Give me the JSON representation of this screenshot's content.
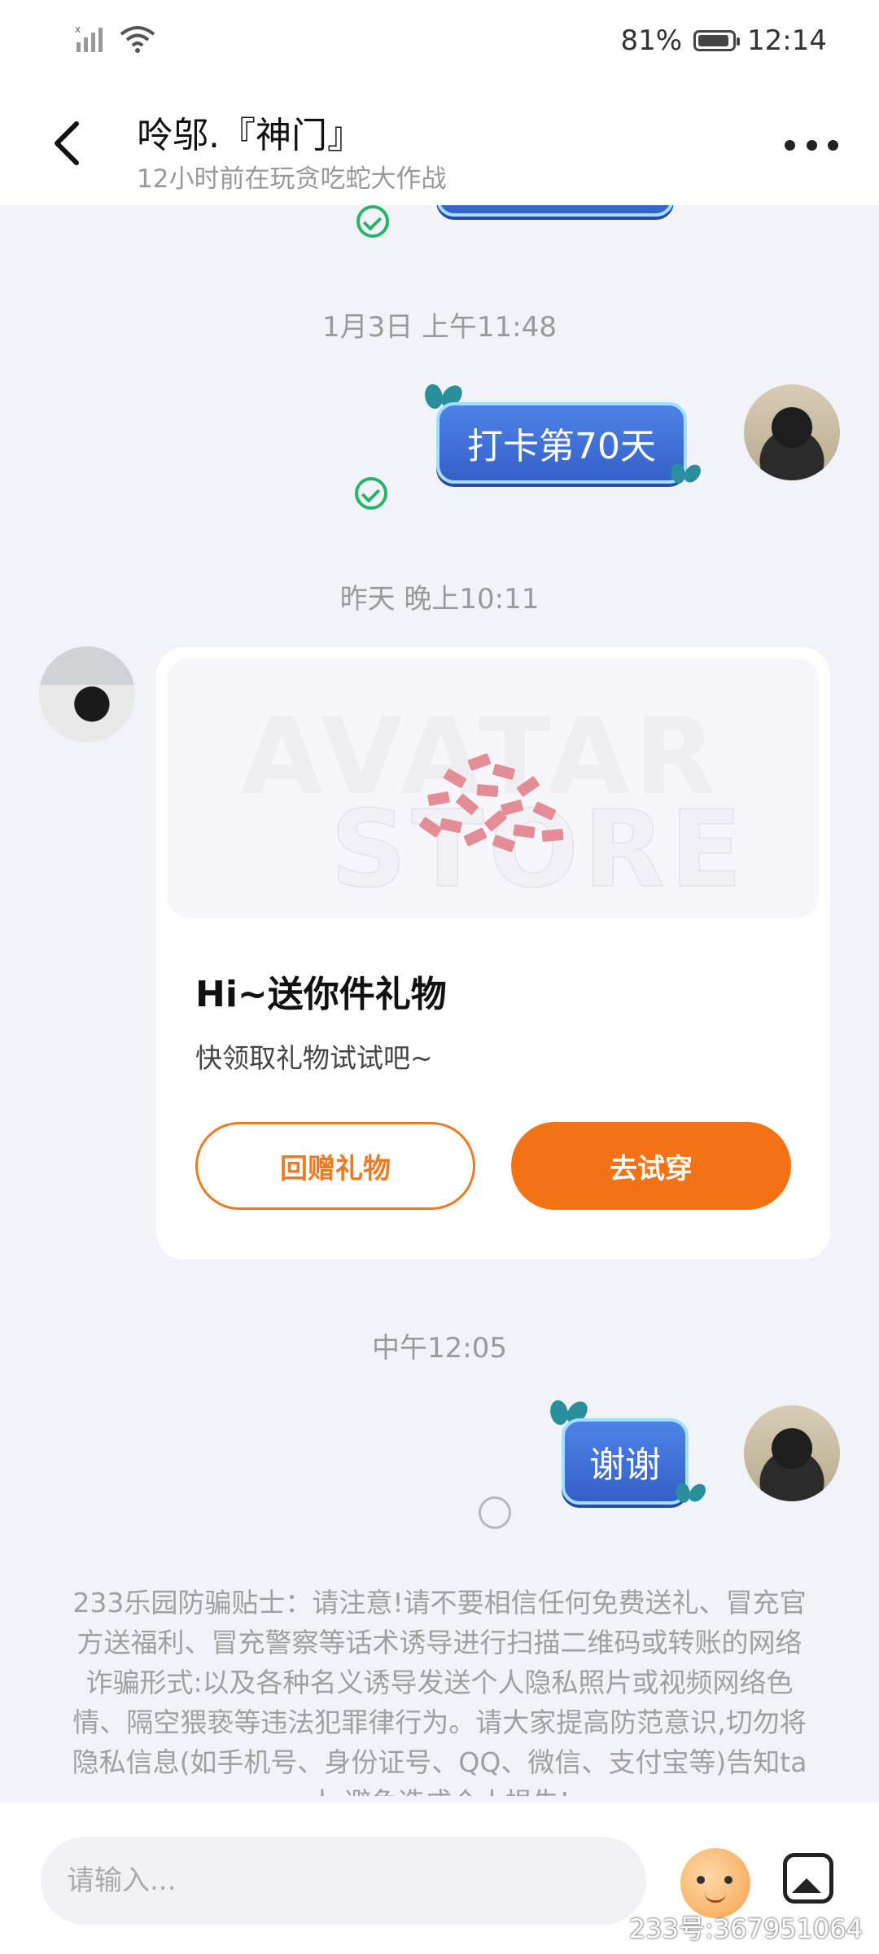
{
  "status_bar": {
    "battery_percent": "81%",
    "battery_level": 0.81,
    "time": "12:14"
  },
  "header": {
    "title": "呤邬.『神门』",
    "subtitle": "12小时前在玩贪吃蛇大作战"
  },
  "messages": {
    "ts1": "1月3日 上午11:48",
    "checkin_text": "打卡第70天",
    "ts2": "昨天 晚上10:11",
    "gift": {
      "watermark_line1": "AVATAR",
      "watermark_line2": "STORE",
      "title": "Hi~送你件礼物",
      "desc": "快领取礼物试试吧~",
      "return_gift_label": "回赠礼物",
      "try_on_label": "去试穿"
    },
    "ts3": "中午12:05",
    "thanks_text": "谢谢"
  },
  "notice": "233乐园防骗贴士：请注意!请不要相信任何免费送礼、冒充官方送福利、冒充警察等话术诱导进行扫描二维码或转账的网络诈骗形式:以及各种名义诱导发送个人隐私照片或视频网络色情、隔空猥亵等违法犯罪律行为。请大家提高防范意识,切勿将隐私信息(如手机号、身份证号、QQ、微信、支付宝等)告知ta人,避免造成个人损失!",
  "input": {
    "placeholder": "请输入..."
  },
  "watermark_id": "233号:367951064",
  "colors": {
    "accent": "#f47216",
    "check_green": "#27b36a",
    "bubble_blue": "#3a6bd2"
  }
}
